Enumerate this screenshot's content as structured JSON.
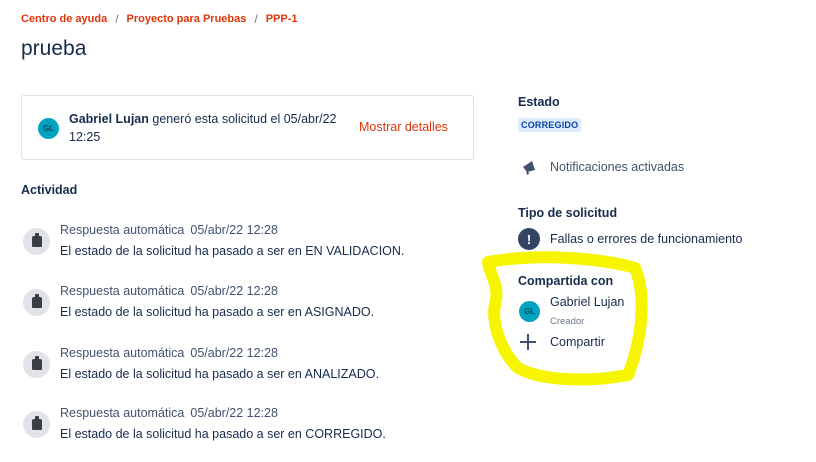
{
  "breadcrumb": [
    {
      "label": "Centro de ayuda"
    },
    {
      "label": "Proyecto para Pruebas"
    },
    {
      "label": "PPP-1"
    }
  ],
  "breadcrumb_separator": "/",
  "title": "prueba",
  "summary": {
    "avatar_initials": "GL",
    "author": "Gabriel Lujan",
    "text": " generó esta solicitud el 05/abr/22 12:25",
    "show_details": "Mostrar detalles"
  },
  "activity": {
    "heading": "Actividad",
    "items": [
      {
        "author": "Respuesta automática",
        "time": "05/abr/22 12:28",
        "text": "El estado de la solicitud ha pasado a ser en EN VALIDACION."
      },
      {
        "author": "Respuesta automática",
        "time": "05/abr/22 12:28",
        "text": "El estado de la solicitud ha pasado a ser en ASIGNADO."
      },
      {
        "author": "Respuesta automática",
        "time": "05/abr/22 12:28",
        "text": "El estado de la solicitud ha pasado a ser en ANALIZADO."
      },
      {
        "author": "Respuesta automática",
        "time": "05/abr/22 12:28",
        "text": "El estado de la solicitud ha pasado a ser en CORREGIDO."
      }
    ],
    "icon": "robot-icon"
  },
  "sidebar": {
    "status_heading": "Estado",
    "status_value": "CORREGIDO",
    "notifications_label": "Notificaciones activadas",
    "request_type_heading": "Tipo de solicitud",
    "request_type_value": "Fallas o errores de funcionamiento",
    "shared_heading": "Compartida con",
    "shared_user": {
      "initials": "GL",
      "name": "Gabriel Lujan",
      "role": "Creador"
    },
    "share_label": "Compartir"
  },
  "colors": {
    "link": "#de350b",
    "text": "#172b4d",
    "status_bg": "#deebff",
    "status_text": "#0747a6",
    "avatar": "#00a3bf",
    "highlight": "#f7f400"
  },
  "icons": [
    "megaphone-icon",
    "exclamation-icon",
    "plus-icon",
    "robot-icon"
  ]
}
